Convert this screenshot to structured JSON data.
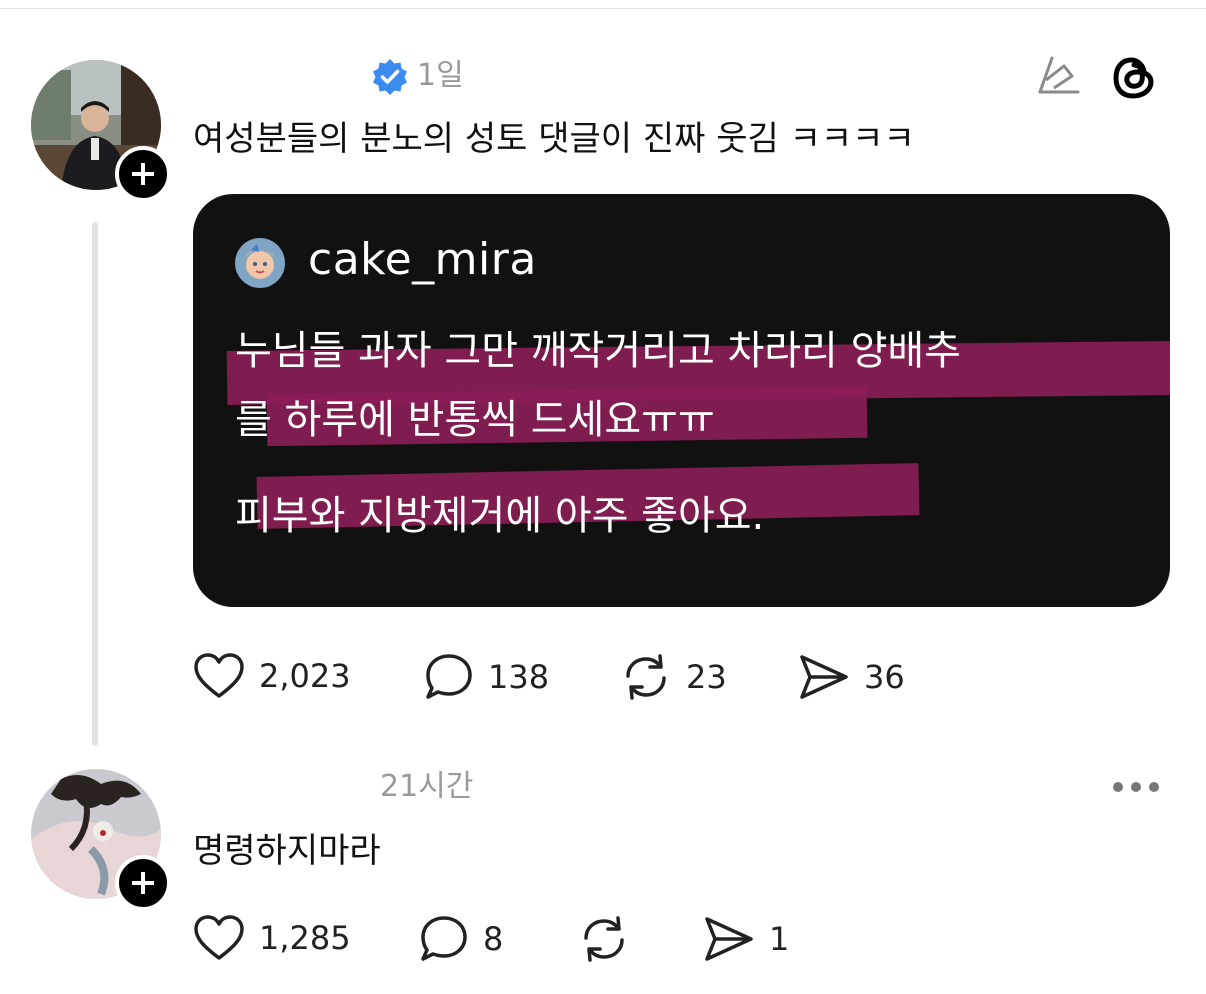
{
  "post": {
    "time": "1일",
    "text": "여성분들의 분노의 성토 댓글이 진짜 웃김 ㅋㅋㅋㅋ",
    "quote": {
      "username": "cake_mira",
      "line1": "누님들 과자 그만 깨작거리고 차라리 양배추",
      "line2": "를 하루에 반통씩 드세요ㅠㅠ",
      "line3": "피부와 지방제거에 아주 좋아요."
    },
    "likes": "2,023",
    "replies": "138",
    "reposts": "23",
    "shares": "36"
  },
  "reply": {
    "time": "21시간",
    "text": "명령하지마라",
    "likes": "1,285",
    "replies": "8",
    "shares": "1"
  },
  "colors": {
    "verified_blue": "#3c8cf0",
    "highlight_magenta": "#8c1e58",
    "quote_background": "#111111"
  }
}
